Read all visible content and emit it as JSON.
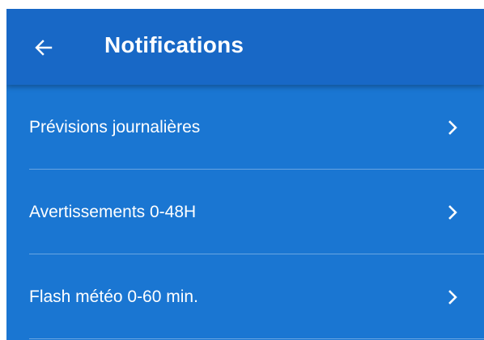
{
  "appbar": {
    "title": "Notifications",
    "back_icon": "arrow-left-icon"
  },
  "colors": {
    "appbar_bg": "#1868c6",
    "list_bg": "#1a76d2",
    "text": "#ffffff"
  },
  "items": [
    {
      "label": "Prévisions journalières",
      "icon": "chevron-right-icon"
    },
    {
      "label": "Avertissements 0-48H",
      "icon": "chevron-right-icon"
    },
    {
      "label": "Flash météo 0-60 min.",
      "icon": "chevron-right-icon"
    }
  ]
}
